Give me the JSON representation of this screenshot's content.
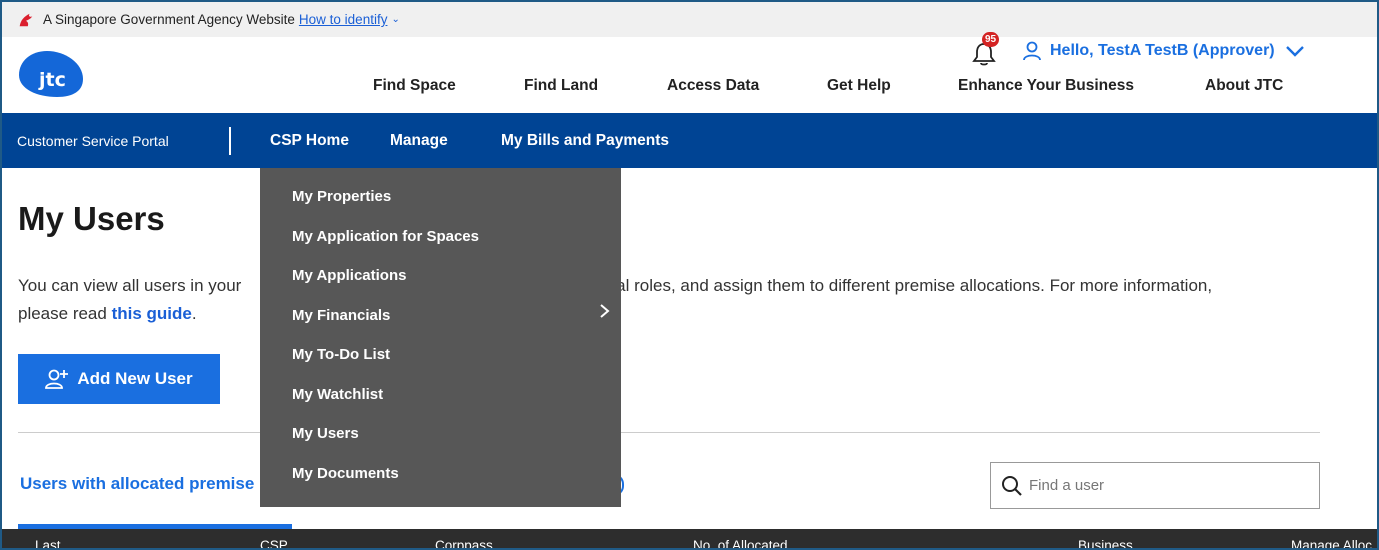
{
  "gov_banner": {
    "text": "A Singapore Government Agency Website",
    "link": "How to identify"
  },
  "header": {
    "logo_text": "jtc",
    "notification_count": "95",
    "greeting": "Hello, TestA TestB (Approver)",
    "nav": [
      "Find Space",
      "Find Land",
      "Access Data",
      "Get Help",
      "Enhance Your Business",
      "About JTC"
    ]
  },
  "portal_bar": {
    "title": "Customer Service Portal",
    "nav": [
      "CSP Home",
      "Manage",
      "My Bills and Payments"
    ]
  },
  "dropdown": {
    "items": [
      "My Properties",
      "My Application for Spaces",
      "My Applications",
      "My Financials",
      "My To-Do List",
      "My Watchlist",
      "My Users",
      "My Documents"
    ]
  },
  "page": {
    "title": "My Users",
    "intro_part1": "You can view all users in your",
    "intro_part2": "ortal roles, and assign them to different premise allocations. For more information,",
    "intro_part3": "please read",
    "intro_link": "this guide",
    "intro_end": ".",
    "add_button": "Add New User",
    "tab_label": "Users with allocated premise",
    "search_placeholder": "Find a user"
  },
  "table": {
    "headers": [
      "Last",
      "CSP",
      "Corppass",
      "No. of Allocated",
      "Business",
      "Manage Alloc"
    ]
  },
  "colors": {
    "portal_bar": "#004494",
    "accent": "#1a6fe0",
    "dropdown_bg": "#575757",
    "badge": "#d32323"
  }
}
